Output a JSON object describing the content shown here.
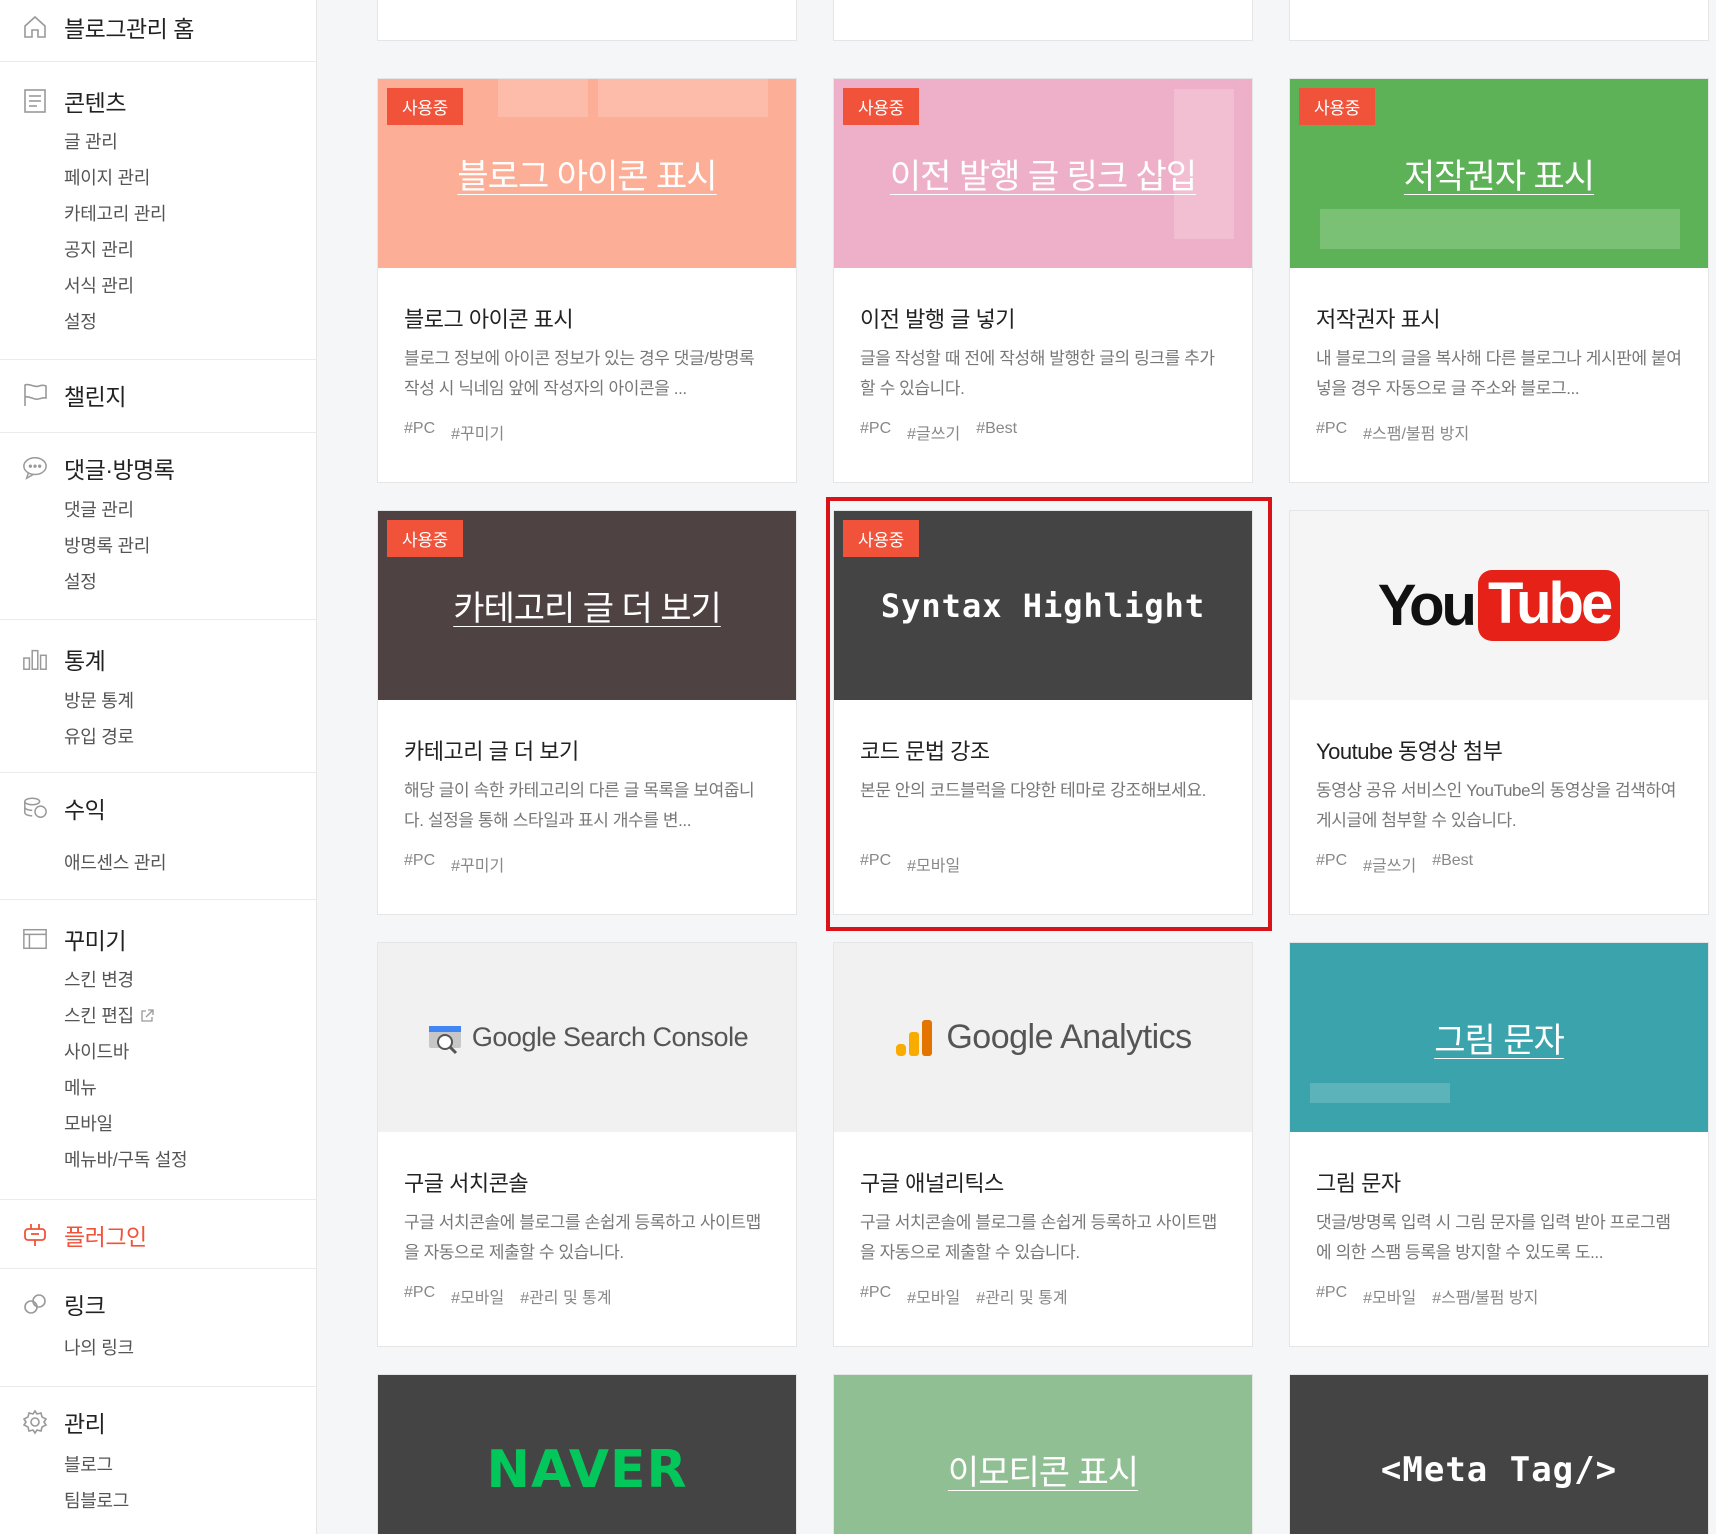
{
  "sidebar": {
    "home": "블로그관리 홈",
    "contents": {
      "label": "콘텐츠",
      "items": [
        "글 관리",
        "페이지 관리",
        "카테고리 관리",
        "공지 관리",
        "서식 관리",
        "설정"
      ]
    },
    "challenge": {
      "label": "챌린지"
    },
    "comments": {
      "label": "댓글·방명록",
      "items": [
        "댓글 관리",
        "방명록 관리",
        "설정"
      ]
    },
    "stats": {
      "label": "통계",
      "items": [
        "방문 통계",
        "유입 경로"
      ]
    },
    "revenue": {
      "label": "수익",
      "items": [
        "애드센스 관리"
      ]
    },
    "decorate": {
      "label": "꾸미기",
      "items": [
        "스킨 변경",
        "스킨 편집",
        "사이드바",
        "메뉴",
        "모바일",
        "메뉴바/구독 설정"
      ]
    },
    "plugin": {
      "label": "플러그인"
    },
    "link": {
      "label": "링크",
      "items": [
        "나의 링크"
      ]
    },
    "manage": {
      "label": "관리",
      "items": [
        "블로그",
        "팀블로그"
      ]
    }
  },
  "badge_label": "사용중",
  "cards": [
    {
      "thumb_title": "블로그 아이콘 표시",
      "title": "블로그 아이콘 표시",
      "desc": "블로그 정보에 아이콘 정보가 있는 경우 댓글/방명록 작성 시 닉네임 앞에 작성자의 아이콘을 ...",
      "tags": [
        "#PC",
        "#꾸미기"
      ],
      "color": "#fdae96",
      "in_use": true
    },
    {
      "thumb_title": "이전 발행 글 링크 삽입",
      "title": "이전 발행 글 넣기",
      "desc": "글을 작성할 때 전에 작성해 발행한 글의 링크를 추가할 수 있습니다.",
      "tags": [
        "#PC",
        "#글쓰기",
        "#Best"
      ],
      "color": "#eeb0c8",
      "in_use": true
    },
    {
      "thumb_title": "저작권자 표시",
      "title": "저작권자 표시",
      "desc": "내 블로그의 글을 복사해 다른 블로그나 게시판에 붙여넣을 경우 자동으로 글 주소와 블로그...",
      "tags": [
        "#PC",
        "#스팸/불펌 방지"
      ],
      "color": "#5db257",
      "in_use": true
    },
    {
      "thumb_title": "카테고리 글 더 보기",
      "title": "카테고리 글 더 보기",
      "desc": "해당 글이 속한 카테고리의 다른 글 목록을 보여줍니다. 설정을 통해 스타일과 표시 개수를 변...",
      "tags": [
        "#PC",
        "#꾸미기"
      ],
      "color": "#4e4342",
      "in_use": true
    },
    {
      "thumb_title": "Syntax Highlight",
      "title": "코드 문법 강조",
      "desc": "본문 안의 코드블럭을 다양한 테마로 강조해보세요.",
      "tags": [
        "#PC",
        "#모바일"
      ],
      "color": "#444444",
      "in_use": true
    },
    {
      "thumb_title": "YouTube",
      "title": "Youtube 동영상 첨부",
      "desc": "동영상 공유 서비스인 YouTube의 동영상을 검색하여 게시글에 첨부할 수 있습니다.",
      "tags": [
        "#PC",
        "#글쓰기",
        "#Best"
      ],
      "color": "#f5f5f5",
      "in_use": false
    },
    {
      "thumb_title": "Google Search Console",
      "title": "구글 서치콘솔",
      "desc": "구글 서치콘솔에 블로그를 손쉽게 등록하고 사이트맵을 자동으로 제출할 수 있습니다.",
      "tags": [
        "#PC",
        "#모바일",
        "#관리 및 통계"
      ],
      "color": "#f1f1f1",
      "in_use": false
    },
    {
      "thumb_title": "Google Analytics",
      "title": "구글 애널리틱스",
      "desc": "구글 서치콘솔에 블로그를 손쉽게 등록하고 사이트맵을 자동으로 제출할 수 있습니다.",
      "tags": [
        "#PC",
        "#모바일",
        "#관리 및 통계"
      ],
      "color": "#f1f1f1",
      "in_use": false
    },
    {
      "thumb_title": "그림 문자",
      "title": "그림 문자",
      "desc": "댓글/방명록 입력 시 그림 문자를 입력 받아 프로그램에 의한 스팸 등록을 방지할 수 있도록 도...",
      "tags": [
        "#PC",
        "#모바일",
        "#스팸/불펌 방지"
      ],
      "color": "#3aa3ab",
      "in_use": false
    },
    {
      "thumb_title": "NAVER",
      "color": "#444444",
      "in_use": false
    },
    {
      "thumb_title": "이모티콘 표시",
      "color": "#8fbf93",
      "in_use": false
    },
    {
      "thumb_title": "<Meta Tag/>",
      "color": "#444444",
      "in_use": false
    }
  ]
}
